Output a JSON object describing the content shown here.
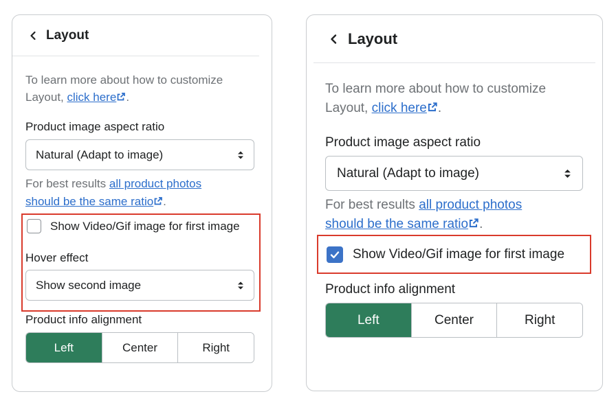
{
  "left": {
    "title": "Layout",
    "intro_text": "To learn more about how to customize Layout,",
    "intro_link": "click here",
    "aspect_label": "Product image aspect ratio",
    "aspect_value": "Natural (Adapt to image)",
    "best_results_text": "For best results",
    "best_results_link": "all product photos should be the same ratio",
    "video_checkbox_label": "Show Video/Gif image for first image",
    "video_checkbox_checked": false,
    "hover_label": "Hover effect",
    "hover_value": "Show second image",
    "alignment_label": "Product info alignment",
    "alignment_options": [
      "Left",
      "Center",
      "Right"
    ],
    "alignment_selected": "Left"
  },
  "right": {
    "title": "Layout",
    "intro_text": "To learn more about how to customize Layout,",
    "intro_link": "click here",
    "aspect_label": "Product image aspect ratio",
    "aspect_value": "Natural (Adapt to image)",
    "best_results_text": "For best results",
    "best_results_link": "all product photos should be the same ratio",
    "video_checkbox_label": "Show Video/Gif image for first image",
    "video_checkbox_checked": true,
    "alignment_label": "Product info alignment",
    "alignment_options": [
      "Left",
      "Center",
      "Right"
    ],
    "alignment_selected": "Left"
  },
  "icons": {
    "back": "chevron-left-icon",
    "external": "external-link-icon",
    "select": "select-arrows-icon",
    "check": "checkmark-icon"
  },
  "colors": {
    "highlight": "#d93a2b",
    "accent_green": "#2e7d5b",
    "link_blue": "#2c6ecb",
    "checkbox_blue": "#3c73c7"
  }
}
